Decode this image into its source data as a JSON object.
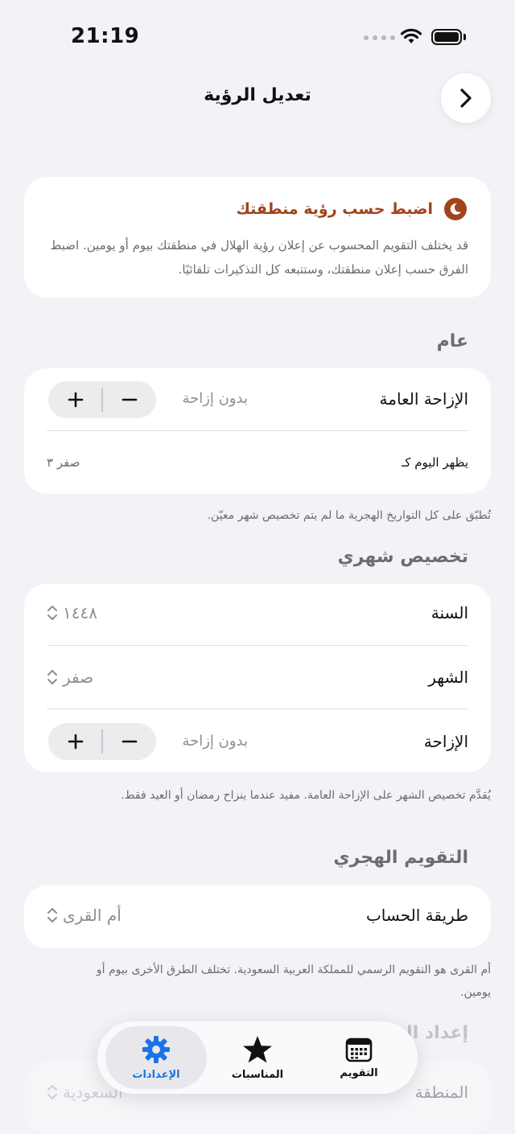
{
  "status_bar": {
    "time": "21:19"
  },
  "header": {
    "title": "تعديل الرؤية"
  },
  "info_card": {
    "title": "اضبط حسب رؤية منطقتك",
    "body": "قد يختلف التقويم المحسوب عن إعلان رؤية الهلال في منطقتك بيوم أو يومين. اضبط الفرق حسب إعلان منطقتك، وستتبعه كل التذكيرات تلقائيًا."
  },
  "general": {
    "section_title": "عام",
    "offset_label": "الإزاحة العامة",
    "offset_value": "بدون إزاحة",
    "preview_label": "يظهر اليوم كـ",
    "preview_value": "صفر ٣",
    "footnote": "تُطبّق على كل التواريخ الهجرية ما لم يتم تخصيص شهر معيّن."
  },
  "monthly": {
    "section_title": "تخصيص شهري",
    "year_label": "السنة",
    "year_value": "١٤٤٨",
    "month_label": "الشهر",
    "month_value": "صفر",
    "offset_label": "الإزاحة",
    "offset_value": "بدون إزاحة",
    "footnote": "يُقدَّم تخصيص الشهر على الإزاحة العامة. مفيد عندما ينزاح رمضان أو العيد فقط."
  },
  "hijri": {
    "section_title": "التقويم الهجري",
    "method_label": "طريقة الحساب",
    "method_value": "أم القرى",
    "footnote": "أم القرى هو التقويم الرسمي للمملكة العربية السعودية. تختلف الطرق الأخرى بيوم أو يومين."
  },
  "next_section": {
    "section_title": "إعداد المنطقة",
    "region_label": "المنطقة",
    "region_value": "السعودية"
  },
  "tabbar": {
    "tabs": [
      {
        "label": "التقويم",
        "icon": "calendar-icon"
      },
      {
        "label": "المناسبات",
        "icon": "star-icon"
      },
      {
        "label": "الإعدادات",
        "icon": "gear-icon"
      }
    ],
    "active_color": "#1a73e8"
  },
  "colors": {
    "accent": "#a0441c",
    "background": "#f2f2f7"
  }
}
